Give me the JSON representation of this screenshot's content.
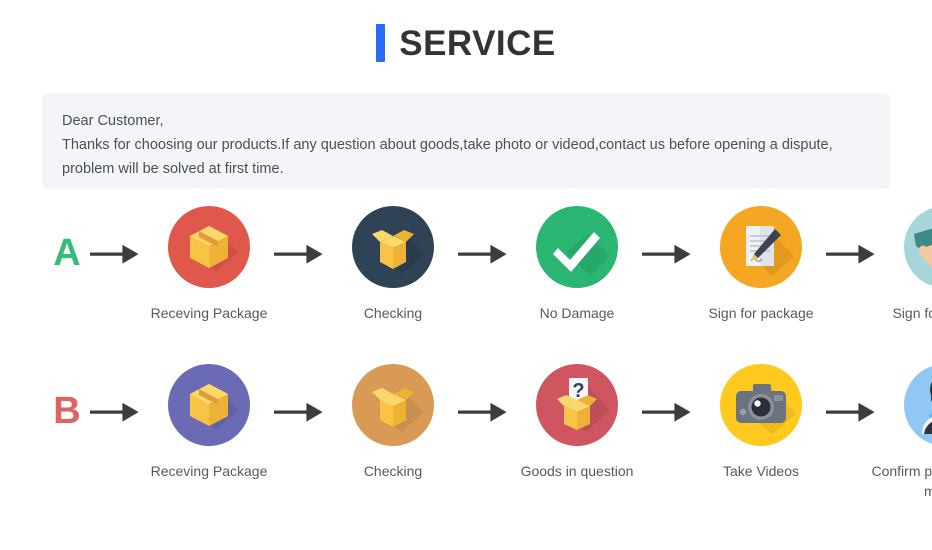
{
  "header": {
    "title": "SERVICE",
    "accent_color": "#2b6af5"
  },
  "notice": {
    "line1": "Dear Customer,",
    "line2": "Thanks for choosing our products.If any question about goods,take photo or videod,contact us before opening a dispute,",
    "line3": "problem will be solved at first time.",
    "background_color": "#f4f5f9"
  },
  "rows": [
    {
      "letter": "A",
      "letter_color": "#35bd77",
      "steps": [
        {
          "label": "Receving Package",
          "icon": "closed-box-icon",
          "circle_color": "#e0574b"
        },
        {
          "label": "Checking",
          "icon": "open-box-icon",
          "circle_color": "#2e4356"
        },
        {
          "label": "No Damage",
          "icon": "check-mark-icon",
          "circle_color": "#2bb573"
        },
        {
          "label": "Sign for package",
          "icon": "document-pen-icon",
          "circle_color": "#f5a623"
        },
        {
          "label": "Sign for package",
          "icon": "handshake-icon",
          "circle_color": "#a6d6d9"
        }
      ]
    },
    {
      "letter": "B",
      "letter_color": "#dc6464",
      "steps": [
        {
          "label": "Receving Package",
          "icon": "closed-box-icon",
          "circle_color": "#6a6ab5"
        },
        {
          "label": "Checking",
          "icon": "open-box-icon",
          "circle_color": "#d99a55"
        },
        {
          "label": "Goods in question",
          "icon": "question-box-icon",
          "circle_color": "#cf5560"
        },
        {
          "label": "Take Videos",
          "icon": "camera-icon",
          "circle_color": "#ffc91e"
        },
        {
          "label": "Confirm  problem,refund money",
          "icon": "person-avatar-icon",
          "circle_color": "#8fc8f5"
        }
      ]
    }
  ],
  "arrow": {
    "name": "right-arrow-icon",
    "color": "#3d3d3d"
  }
}
